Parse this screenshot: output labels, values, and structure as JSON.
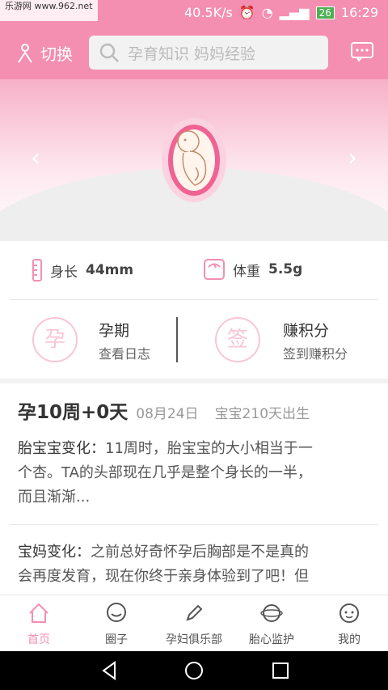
{
  "status": {
    "watermark": "乐游网 www.962.net",
    "speed": "40.5K/s",
    "battery": "26",
    "time": "16:29"
  },
  "topbar": {
    "switch_label": "切换",
    "search_placeholder": "孕育知识 妈妈经验"
  },
  "metrics": {
    "length_label": "身长",
    "length_value": "44mm",
    "weight_label": "体重",
    "weight_value": "5.5g"
  },
  "quick": {
    "left_badge": "孕",
    "left_title": "孕期",
    "left_sub": "查看日志",
    "right_badge": "签",
    "right_title": "赚积分",
    "right_sub": "签到赚积分"
  },
  "week": {
    "title": "孕10周+0天",
    "date": "08月24日",
    "birth": "宝宝210天出生"
  },
  "baby_change": {
    "label": "胎宝宝变化：",
    "line1": "11周时，胎宝宝的大小相当于一",
    "line2": "个杏。TA的头部现在几乎是整个身长的一半，",
    "line3": "而且渐渐..."
  },
  "mom_change": {
    "label": "宝妈变化：",
    "line1": "之前总好奇怀孕后胸部是不是真的",
    "line2": "会再度发育，现在你终于亲身体验到了吧！但"
  },
  "tabs": [
    {
      "label": "首页"
    },
    {
      "label": "圈子"
    },
    {
      "label": "孕妇俱乐部"
    },
    {
      "label": "胎心监护"
    },
    {
      "label": "我的"
    }
  ],
  "colors": {
    "accent": "#f48fb1",
    "badge": "#f8c6d6"
  }
}
